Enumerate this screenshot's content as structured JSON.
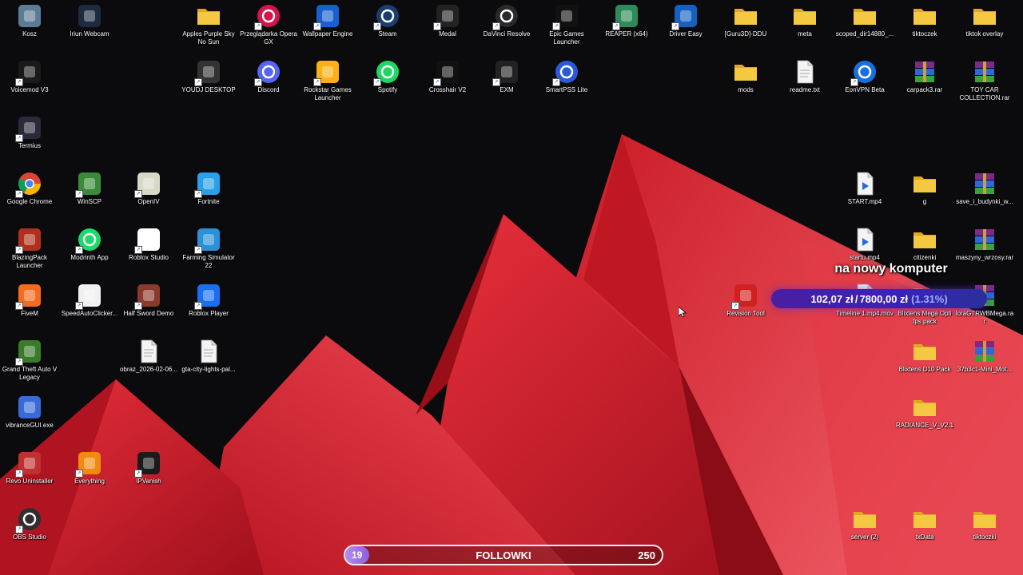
{
  "desktop_icons": [
    {
      "label": "Kosz",
      "icon": "recycle-bin-icon",
      "color": "#5c7c96",
      "shortcut": false
    },
    {
      "label": "Iriun Webcam",
      "icon": "webcam-icon",
      "color": "#1e2a40",
      "shortcut": false
    },
    {
      "label": "Apples Purple Sky No Sun",
      "icon": "folder-icon",
      "color": "#f5c842",
      "shortcut": false
    },
    {
      "label": "Przeglądarka Opera GX",
      "icon": "opera-gx-icon",
      "color": "#d4154c",
      "shortcut": true
    },
    {
      "label": "Wallpaper Engine",
      "icon": "wallpaper-engine-icon",
      "color": "#1a5fd0",
      "shortcut": true
    },
    {
      "label": "Steam",
      "icon": "steam-icon",
      "color": "#1b3d6e",
      "shortcut": true
    },
    {
      "label": "Medal",
      "icon": "medal-icon",
      "color": "#222222",
      "shortcut": true
    },
    {
      "label": "DaVinci Resolve",
      "icon": "davinci-resolve-icon",
      "color": "#2a2a2a",
      "shortcut": true
    },
    {
      "label": "Epic Games Launcher",
      "icon": "epic-games-icon",
      "color": "#111111",
      "shortcut": true
    },
    {
      "label": "REAPER (x64)",
      "icon": "reaper-icon",
      "color": "#2f8a5a",
      "shortcut": true
    },
    {
      "label": "Driver Easy",
      "icon": "driver-easy-icon",
      "color": "#1560c0",
      "shortcut": true
    },
    {
      "label": "[Guru3D]-DDU",
      "icon": "folder-icon",
      "color": "#f5c842",
      "shortcut": false
    },
    {
      "label": "meta",
      "icon": "folder-icon",
      "color": "#f5c842",
      "shortcut": false
    },
    {
      "label": "scoped_dir14880_...",
      "icon": "folder-icon",
      "color": "#f5c842",
      "shortcut": false
    },
    {
      "label": "tiktoczek",
      "icon": "folder-icon",
      "color": "#f5c842",
      "shortcut": false
    },
    {
      "label": "tiktok overlay",
      "icon": "folder-icon",
      "color": "#f5c842",
      "shortcut": false
    },
    {
      "label": "Voicemod V3",
      "icon": "voicemod-icon",
      "color": "#1a1a1a",
      "shortcut": true
    },
    {
      "label": "YOUDJ DESKTOP",
      "icon": "youdj-icon",
      "color": "#333333",
      "shortcut": true
    },
    {
      "label": "Discord",
      "icon": "discord-icon",
      "color": "#5865f2",
      "shortcut": true
    },
    {
      "label": "Rockstar Games Launcher",
      "icon": "rockstar-icon",
      "color": "#fcaf17",
      "shortcut": true
    },
    {
      "label": "Spotify",
      "icon": "spotify-icon",
      "color": "#1ed760",
      "shortcut": true
    },
    {
      "label": "Crosshair V2",
      "icon": "crosshair-icon",
      "color": "#111111",
      "shortcut": true
    },
    {
      "label": "EXM",
      "icon": "exm-icon",
      "color": "#222222",
      "shortcut": true
    },
    {
      "label": "SmartPSS Lite",
      "icon": "smartpss-icon",
      "color": "#2a5ad8",
      "shortcut": true
    },
    {
      "label": "mods",
      "icon": "folder-icon",
      "color": "#f5c842",
      "shortcut": false
    },
    {
      "label": "readme.txt",
      "icon": "text-file-icon",
      "color": "#f0f0f0",
      "shortcut": false
    },
    {
      "label": "EonVPN Beta",
      "icon": "eonvpn-icon",
      "color": "#1a6fe0",
      "shortcut": true
    },
    {
      "label": "carpack3.rar",
      "icon": "winrar-archive-icon",
      "color": "#8a2a6a",
      "shortcut": false
    },
    {
      "label": "TOY CAR COLLECTION.rar",
      "icon": "winrar-archive-icon",
      "color": "#8a2a6a",
      "shortcut": false
    },
    {
      "label": "Termius",
      "icon": "termius-icon",
      "color": "#2a2a3a",
      "shortcut": true
    },
    {
      "label": "Google Chrome",
      "icon": "chrome-icon",
      "color": "#4285f4",
      "shortcut": true
    },
    {
      "label": "WinSCP",
      "icon": "winscp-icon",
      "color": "#3a8a3a",
      "shortcut": true
    },
    {
      "label": "OpenIV",
      "icon": "openiv-icon",
      "color": "#d8d8c8",
      "shortcut": true
    },
    {
      "label": "Fortnite",
      "icon": "fortnite-icon",
      "color": "#2aa0e8",
      "shortcut": true
    },
    {
      "label": "START.mp4",
      "icon": "video-file-icon",
      "color": "#e8e8e8",
      "shortcut": false
    },
    {
      "label": "g",
      "icon": "folder-icon",
      "color": "#f5c842",
      "shortcut": false
    },
    {
      "label": "save_i_budynki_w...",
      "icon": "winrar-archive-icon",
      "color": "#8a2a6a",
      "shortcut": false
    },
    {
      "label": "BlazingPack Launcher",
      "icon": "blazingpack-icon",
      "color": "#b03020",
      "shortcut": true
    },
    {
      "label": "Modrinth App",
      "icon": "modrinth-icon",
      "color": "#1bd96a",
      "shortcut": true
    },
    {
      "label": "Roblox Studio",
      "icon": "roblox-studio-icon",
      "color": "#ffffff",
      "shortcut": true
    },
    {
      "label": "Farming Simulator 22",
      "icon": "farming-simulator-icon",
      "color": "#2a90d8",
      "shortcut": true
    },
    {
      "label": "startu.mp4",
      "icon": "video-file-icon",
      "color": "#e8e8e8",
      "shortcut": false
    },
    {
      "label": "citizenki",
      "icon": "folder-icon",
      "color": "#f5c842",
      "shortcut": false
    },
    {
      "label": "maszyny_wrzosy.rar",
      "icon": "winrar-archive-icon",
      "color": "#8a2a6a",
      "shortcut": false
    },
    {
      "label": "FiveM",
      "icon": "fivem-icon",
      "color": "#f26b21",
      "shortcut": true
    },
    {
      "label": "SpeedAutoClicker...",
      "icon": "mouse-icon",
      "color": "#f0f0f0",
      "shortcut": true
    },
    {
      "label": "Half Sword Demo",
      "icon": "half-sword-icon",
      "color": "#8a3a2a",
      "shortcut": true
    },
    {
      "label": "Roblox Player",
      "icon": "roblox-player-icon",
      "color": "#1a6ff0",
      "shortcut": true
    },
    {
      "label": "Revision Tool",
      "icon": "revision-tool-icon",
      "color": "#d02020",
      "shortcut": true
    },
    {
      "label": "Timeline 1.mp4.mov",
      "icon": "video-file-icon",
      "color": "#e8e8e8",
      "shortcut": false
    },
    {
      "label": "Blixtens Mega Opti fps pack",
      "icon": "folder-icon",
      "color": "#f5c842",
      "shortcut": false
    },
    {
      "label": "loraGTRWBMega.rar",
      "icon": "winrar-archive-icon",
      "color": "#8a2a6a",
      "shortcut": false
    },
    {
      "label": "Grand Theft Auto V Legacy",
      "icon": "gta-v-icon",
      "color": "#3a7a2a",
      "shortcut": true
    },
    {
      "label": "obraz_2026-02-06...",
      "icon": "image-file-icon",
      "color": "#f0f0f0",
      "shortcut": false
    },
    {
      "label": "gta-city-lights-pal...",
      "icon": "text-file-icon",
      "color": "#f0f0f0",
      "shortcut": false
    },
    {
      "label": "Blixtens D10 Pack",
      "icon": "folder-icon",
      "color": "#f5c842",
      "shortcut": false
    },
    {
      "label": "37b3c1-Mini_Mot...",
      "icon": "winrar-archive-icon",
      "color": "#8a2a6a",
      "shortcut": false
    },
    {
      "label": "vibranceGUI.exe",
      "icon": "vibrance-gui-icon",
      "color": "#3a6ad8",
      "shortcut": false
    },
    {
      "label": "RADIANCE_V_V2.1",
      "icon": "folder-icon",
      "color": "#f5c842",
      "shortcut": false
    },
    {
      "label": "Revo Uninstaller",
      "icon": "revo-uninstaller-icon",
      "color": "#c03030",
      "shortcut": true
    },
    {
      "label": "Everything",
      "icon": "everything-search-icon",
      "color": "#f08a10",
      "shortcut": true
    },
    {
      "label": "IPVanish",
      "icon": "ipvanish-icon",
      "color": "#1a1a1a",
      "shortcut": true
    },
    {
      "label": "OBS Studio",
      "icon": "obs-studio-icon",
      "color": "#302e31",
      "shortcut": true
    },
    {
      "label": "server (2)",
      "icon": "folder-icon",
      "color": "#f5c842",
      "shortcut": false
    },
    {
      "label": "txData",
      "icon": "folder-icon",
      "color": "#f5c842",
      "shortcut": false
    },
    {
      "label": "tiktoczki",
      "icon": "folder-icon",
      "color": "#f5c842",
      "shortcut": false
    }
  ],
  "donation_overlay": {
    "heading": "na nowy komputer",
    "amount": "102,07 zł",
    "separator": "/",
    "goal": "7800,00 zł",
    "percent": "(1.31%)",
    "progress_fraction": 0.0131
  },
  "follow_goal": {
    "title": "FOLLOWKI",
    "current": "19",
    "goal": "250",
    "progress_fraction": 0.076
  },
  "colors": {
    "wallpaper_red": "#d8202c",
    "wallpaper_dark": "#0b0b0d",
    "overlay_purple": "#4a1ea0",
    "follow_fill": "#a27ae8"
  }
}
